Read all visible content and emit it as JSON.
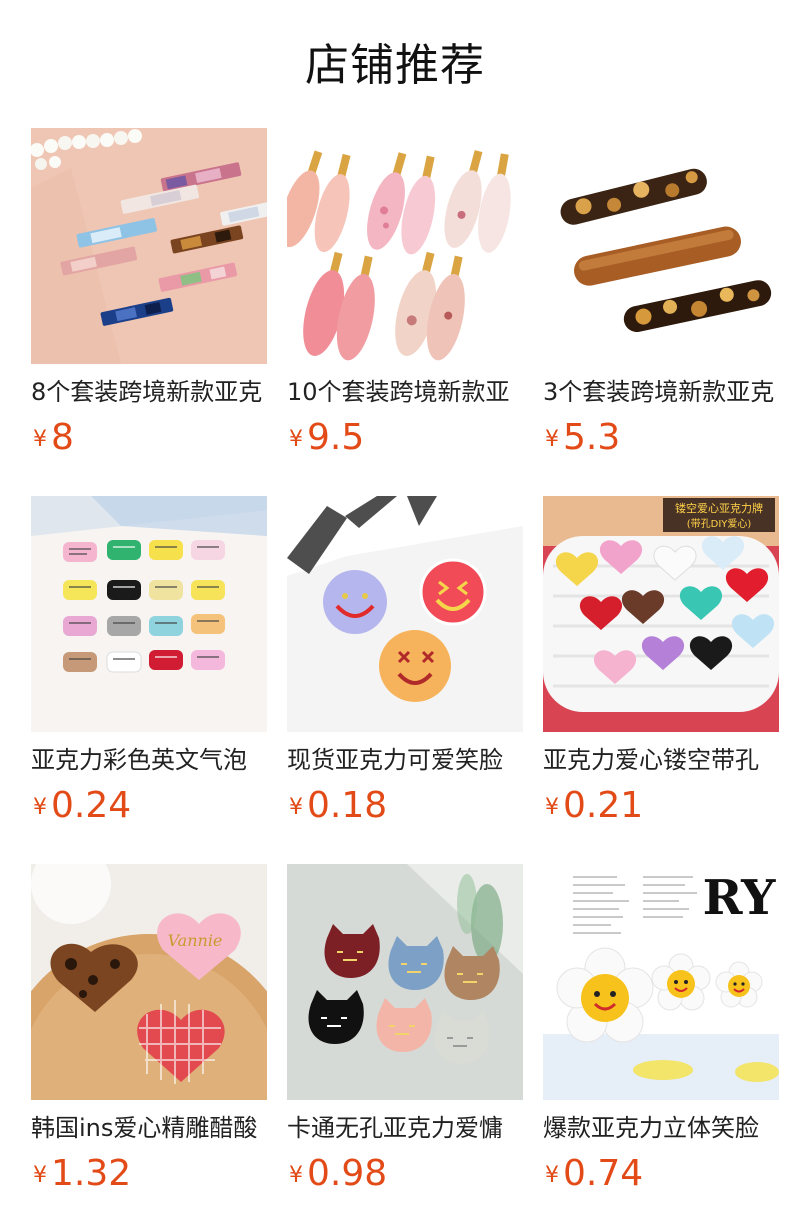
{
  "shop": {
    "title": "店铺推荐"
  },
  "products": [
    {
      "name": "8个套装跨境新款亚克",
      "currency": "¥",
      "price": "8",
      "image_icon": "acrylic-hair-clips-image"
    },
    {
      "name": "10个套装跨境新款亚",
      "currency": "¥",
      "price": "9.5",
      "image_icon": "pink-duckbill-clips-image"
    },
    {
      "name": "3个套装跨境新款亚克",
      "currency": "¥",
      "price": "5.3",
      "image_icon": "tortoiseshell-barrettes-image"
    },
    {
      "name": "亚克力彩色英文气泡",
      "currency": "¥",
      "price": "0.24",
      "image_icon": "speech-bubble-charms-image"
    },
    {
      "name": "现货亚克力可爱笑脸",
      "currency": "¥",
      "price": "0.18",
      "image_icon": "smiley-face-charms-image"
    },
    {
      "name": "亚克力爱心镂空带孔",
      "currency": "¥",
      "price": "0.21",
      "image_icon": "love-heart-charms-image",
      "image_caption_line1": "镂空爱心亚克力牌",
      "image_caption_line2": "(带孔DIY爱心)"
    },
    {
      "name": "韩国ins爱心精雕醋酸",
      "currency": "¥",
      "price": "1.32",
      "image_icon": "vannie-heart-charms-image",
      "image_text": "Vannie"
    },
    {
      "name": "卡通无孔亚克力爱慵",
      "currency": "¥",
      "price": "0.98",
      "image_icon": "cat-face-charms-image"
    },
    {
      "name": "爆款亚克力立体笑脸",
      "currency": "¥",
      "price": "0.74",
      "image_icon": "smiley-daisy-charms-image",
      "image_text": "RY"
    }
  ],
  "colors": {
    "price": "#e24a17",
    "title": "#111111",
    "text": "#222222"
  }
}
